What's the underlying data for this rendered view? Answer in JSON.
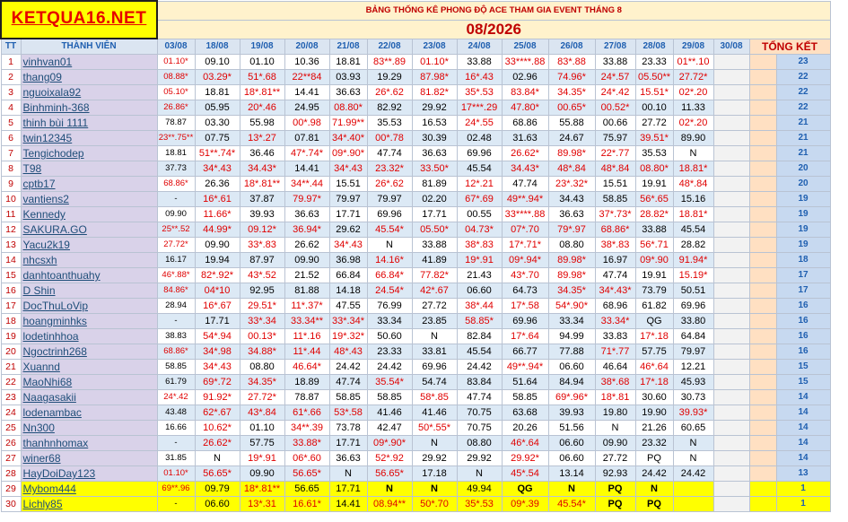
{
  "header": {
    "logo": "KETQUA16.NET",
    "subtitle": "BẢNG THỐNG KÊ PHONG ĐỘ ACE THAM GIA EVENT THÁNG 8",
    "month": "08/2026"
  },
  "columns": {
    "tt": "TT",
    "member": "THÀNH VIÊN",
    "dates": [
      "03/08",
      "18/08",
      "19/08",
      "20/08",
      "21/08",
      "22/08",
      "23/08",
      "24/08",
      "25/08",
      "26/08",
      "27/08",
      "28/08",
      "29/08",
      "30/08"
    ],
    "total": "TỔNG KẾT"
  },
  "rows": [
    {
      "tt": "1",
      "name": "vinhvan01",
      "cells": [
        "01.10*",
        "09.10",
        "01.10",
        "10.36",
        "18.81",
        "83**.89",
        "01.10*",
        "33.88",
        "33****.88",
        "83*.88",
        "33.88",
        "23.33",
        "01**.10",
        ""
      ],
      "rank": "23"
    },
    {
      "tt": "2",
      "name": "thang09",
      "cells": [
        "08.88*",
        "03.29*",
        "51*.68",
        "22**84",
        "03.93",
        "19.29",
        "87.98*",
        "16*.43",
        "02.96",
        "74.96*",
        "24*.57",
        "05.50**",
        "27.72*",
        ""
      ],
      "rank": "22"
    },
    {
      "tt": "3",
      "name": "nguoixala92",
      "cells": [
        "05.10*",
        "18.81",
        "18*.81**",
        "14.41",
        "36.63",
        "26*.62",
        "81.82*",
        "35*.53",
        "83.84*",
        "34.35*",
        "24*.42",
        "15.51*",
        "02*.20",
        ""
      ],
      "rank": "22"
    },
    {
      "tt": "4",
      "name": "Binhminh-368",
      "cells": [
        "26.86*",
        "05.95",
        "20*.46",
        "24.95",
        "08.80*",
        "82.92",
        "29.92",
        "17***.29",
        "47.80*",
        "00.65*",
        "00.52*",
        "00.10",
        "11.33",
        ""
      ],
      "rank": "22"
    },
    {
      "tt": "5",
      "name": "thinh bùi 1111",
      "cells": [
        "78.87",
        "03.30",
        "55.98",
        "00*.98",
        "71.99**",
        "35.53",
        "16.53",
        "24*.55",
        "68.86",
        "55.88",
        "00.66",
        "27.72",
        "02*.20",
        ""
      ],
      "rank": "21"
    },
    {
      "tt": "6",
      "name": "twin12345",
      "cells": [
        "23**.75**",
        "07.75",
        "13*.27",
        "07.81",
        "34*.40*",
        "00*.78",
        "30.39",
        "02.48",
        "31.63",
        "24.67",
        "75.97",
        "39.51*",
        "89.90",
        ""
      ],
      "rank": "21"
    },
    {
      "tt": "7",
      "name": "Tengichodep",
      "cells": [
        "18.81",
        "51**.74*",
        "36.46",
        "47*.74*",
        "09*.90*",
        "47.74",
        "36.63",
        "69.96",
        "26.62*",
        "89.98*",
        "22*.77",
        "35.53",
        "N",
        ""
      ],
      "rank": "21"
    },
    {
      "tt": "8",
      "name": "T98",
      "cells": [
        "37.73",
        "34*.43",
        "34.43*",
        "14.41",
        "34*.43",
        "23.32*",
        "33.50*",
        "45.54",
        "34.43*",
        "48*.84",
        "48*.84",
        "08.80*",
        "18.81*",
        ""
      ],
      "rank": "20"
    },
    {
      "tt": "9",
      "name": "cptb17",
      "cells": [
        "68.86*",
        "26.36",
        "18*.81**",
        "34**.44",
        "15.51",
        "26*.62",
        "81.89",
        "12*.21",
        "47.74",
        "23*.32*",
        "15.51",
        "19.91",
        "48*.84",
        ""
      ],
      "rank": "20"
    },
    {
      "tt": "10",
      "name": "vantiens2",
      "cells": [
        "-",
        "16*.61",
        "37.87",
        "79.97*",
        "79.97",
        "79.97",
        "02.20",
        "67*.69",
        "49**.94*",
        "34.43",
        "58.85",
        "56*.65",
        "15.16",
        ""
      ],
      "rank": "19"
    },
    {
      "tt": "11",
      "name": "Kennedy",
      "cells": [
        "09.90",
        "11.66*",
        "39.93",
        "36.63",
        "17.71",
        "69.96",
        "17.71",
        "00.55",
        "33****.88",
        "36.63",
        "37*.73*",
        "28.82*",
        "18.81*",
        ""
      ],
      "rank": "19"
    },
    {
      "tt": "12",
      "name": "SAKURA.GO",
      "cells": [
        "25**.52",
        "44.99*",
        "09.12*",
        "36.94*",
        "29.62",
        "45.54*",
        "05.50*",
        "04.73*",
        "07*.70",
        "79*.97",
        "68.86*",
        "33.88",
        "45.54",
        ""
      ],
      "rank": "19"
    },
    {
      "tt": "13",
      "name": "Yacu2k19",
      "cells": [
        "27.72*",
        "09.90",
        "33*.83",
        "26.62",
        "34*.43",
        "N",
        "33.88",
        "38*.83",
        "17*.71*",
        "08.80",
        "38*.83",
        "56*.71",
        "28.82",
        ""
      ],
      "rank": "19"
    },
    {
      "tt": "14",
      "name": "nhcsxh",
      "cells": [
        "16.17",
        "19.94",
        "87.97",
        "09.90",
        "36.98",
        "14.16*",
        "41.89",
        "19*.91",
        "09*.94*",
        "89.98*",
        "16.97",
        "09*.90",
        "91.94*",
        ""
      ],
      "rank": "18"
    },
    {
      "tt": "15",
      "name": "danhtoanthuahy",
      "cells": [
        "46*.88*",
        "82*.92*",
        "43*.52",
        "21.52",
        "66.84",
        "66.84*",
        "77.82*",
        "21.43",
        "43*.70",
        "89.98*",
        "47.74",
        "19.91",
        "15.19*",
        ""
      ],
      "rank": "17"
    },
    {
      "tt": "16",
      "name": "D Shin",
      "cells": [
        "84.86*",
        "04*10",
        "92.95",
        "81.88",
        "14.18",
        "24.54*",
        "42*.67",
        "06.60",
        "64.73",
        "34.35*",
        "34*.43*",
        "73.79",
        "50.51",
        ""
      ],
      "rank": "17"
    },
    {
      "tt": "17",
      "name": "DocThuLoVip",
      "cells": [
        "28.94",
        "16*.67",
        "29.51*",
        "11*.37*",
        "47.55",
        "76.99",
        "27.72",
        "38*.44",
        "17*.58",
        "54*.90*",
        "68.96",
        "61.82",
        "69.96",
        ""
      ],
      "rank": "16"
    },
    {
      "tt": "18",
      "name": "hoangminhks",
      "cells": [
        "-",
        "17.71",
        "33*.34",
        "33.34**",
        "33*.34*",
        "33.34",
        "23.85",
        "58.85*",
        "69.96",
        "33.34",
        "33.34*",
        "QG",
        "33.80",
        ""
      ],
      "rank": "16"
    },
    {
      "tt": "19",
      "name": "lodetinhhoa",
      "cells": [
        "38.83",
        "54*.94",
        "00.13*",
        "11*.16",
        "19*.32*",
        "50.60",
        "N",
        "82.84",
        "17*.64",
        "94.99",
        "33.83",
        "17*.18",
        "64.84",
        ""
      ],
      "rank": "16"
    },
    {
      "tt": "20",
      "name": "Ngoctrinh268",
      "cells": [
        "68.86*",
        "34*.98",
        "34.88*",
        "11*.44",
        "48*.43",
        "23.33",
        "33.81",
        "45.54",
        "66.77",
        "77.88",
        "71*.77",
        "57.75",
        "79.97",
        ""
      ],
      "rank": "16"
    },
    {
      "tt": "21",
      "name": "Xuannd",
      "cells": [
        "58.85",
        "34*.43",
        "08.80",
        "46.64*",
        "24.42",
        "24.42",
        "69.96",
        "24.42",
        "49**.94*",
        "06.60",
        "46.64",
        "46*.64",
        "12.21",
        ""
      ],
      "rank": "15"
    },
    {
      "tt": "22",
      "name": "MaoNhi68",
      "cells": [
        "61.79",
        "69*.72",
        "34.35*",
        "18.89",
        "47.74",
        "35.54*",
        "54.74",
        "83.84",
        "51.64",
        "84.94",
        "38*.68",
        "17*.18",
        "45.93",
        ""
      ],
      "rank": "15"
    },
    {
      "tt": "23",
      "name": "Naagasakii",
      "cells": [
        "24*.42",
        "91.92*",
        "27.72*",
        "78.87",
        "58.85",
        "58.85",
        "58*.85",
        "47.74",
        "58.85",
        "69*.96*",
        "18*.81",
        "30.60",
        "30.73",
        ""
      ],
      "rank": "14"
    },
    {
      "tt": "24",
      "name": "lodenambac",
      "cells": [
        "43.48",
        "62*.67",
        "43*.84",
        "61*.66",
        "53*.58",
        "41.46",
        "41.46",
        "70.75",
        "63.68",
        "39.93",
        "19.80",
        "19.90",
        "39.93*",
        ""
      ],
      "rank": "14"
    },
    {
      "tt": "25",
      "name": "Nn300",
      "cells": [
        "16.66",
        "10.62*",
        "01.10",
        "34**.39",
        "73.78",
        "42.47",
        "50*.55*",
        "70.75",
        "20.26",
        "51.56",
        "N",
        "21.26",
        "60.65",
        ""
      ],
      "rank": "14"
    },
    {
      "tt": "26",
      "name": "thanhnhomax",
      "cells": [
        "-",
        "26.62*",
        "57.75",
        "33.88*",
        "17.71",
        "09*.90*",
        "N",
        "08.80",
        "46*.64",
        "06.60",
        "09.90",
        "23.32",
        "N",
        ""
      ],
      "rank": "14"
    },
    {
      "tt": "27",
      "name": "winer68",
      "cells": [
        "31.85",
        "N",
        "19*.91",
        "06*.60",
        "36.63",
        "52*.92",
        "29.92",
        "29.92",
        "29.92*",
        "06.60",
        "27.72",
        "PQ",
        "N",
        ""
      ],
      "rank": "14"
    },
    {
      "tt": "28",
      "name": "HayDoiDay123",
      "cells": [
        "01.10*",
        "56.65*",
        "09.90",
        "56.65*",
        "N",
        "56.65*",
        "17.18",
        "N",
        "45*.54",
        "13.14",
        "92.93",
        "24.42",
        "24.42",
        ""
      ],
      "rank": "13"
    },
    {
      "tt": "29",
      "name": "Mybom444",
      "cells": [
        "69**.96",
        "09.79",
        "18*.81**",
        "56.65",
        "17.71",
        "N",
        "N",
        "49.94",
        "QG",
        "N",
        "PQ",
        "N",
        "",
        ""
      ],
      "rank": "1",
      "highlight": true
    },
    {
      "tt": "30",
      "name": "Lichly85",
      "cells": [
        "-",
        "06.60",
        "13*.31",
        "16.61*",
        "14.41",
        "08.94**",
        "50*.70",
        "35*.53",
        "09*.39",
        "45.54*",
        "PQ",
        "PQ",
        "",
        ""
      ],
      "rank": "1",
      "highlight": true
    }
  ],
  "colors": {
    "logo_bg": "#ffff00",
    "logo_text": "#e60000",
    "title_red": "#c00000",
    "header_blue": "#1f5fb0",
    "name_bg": "#d9d2e9",
    "alt_row": "#dce9f5",
    "highlight": "#ffff00"
  }
}
